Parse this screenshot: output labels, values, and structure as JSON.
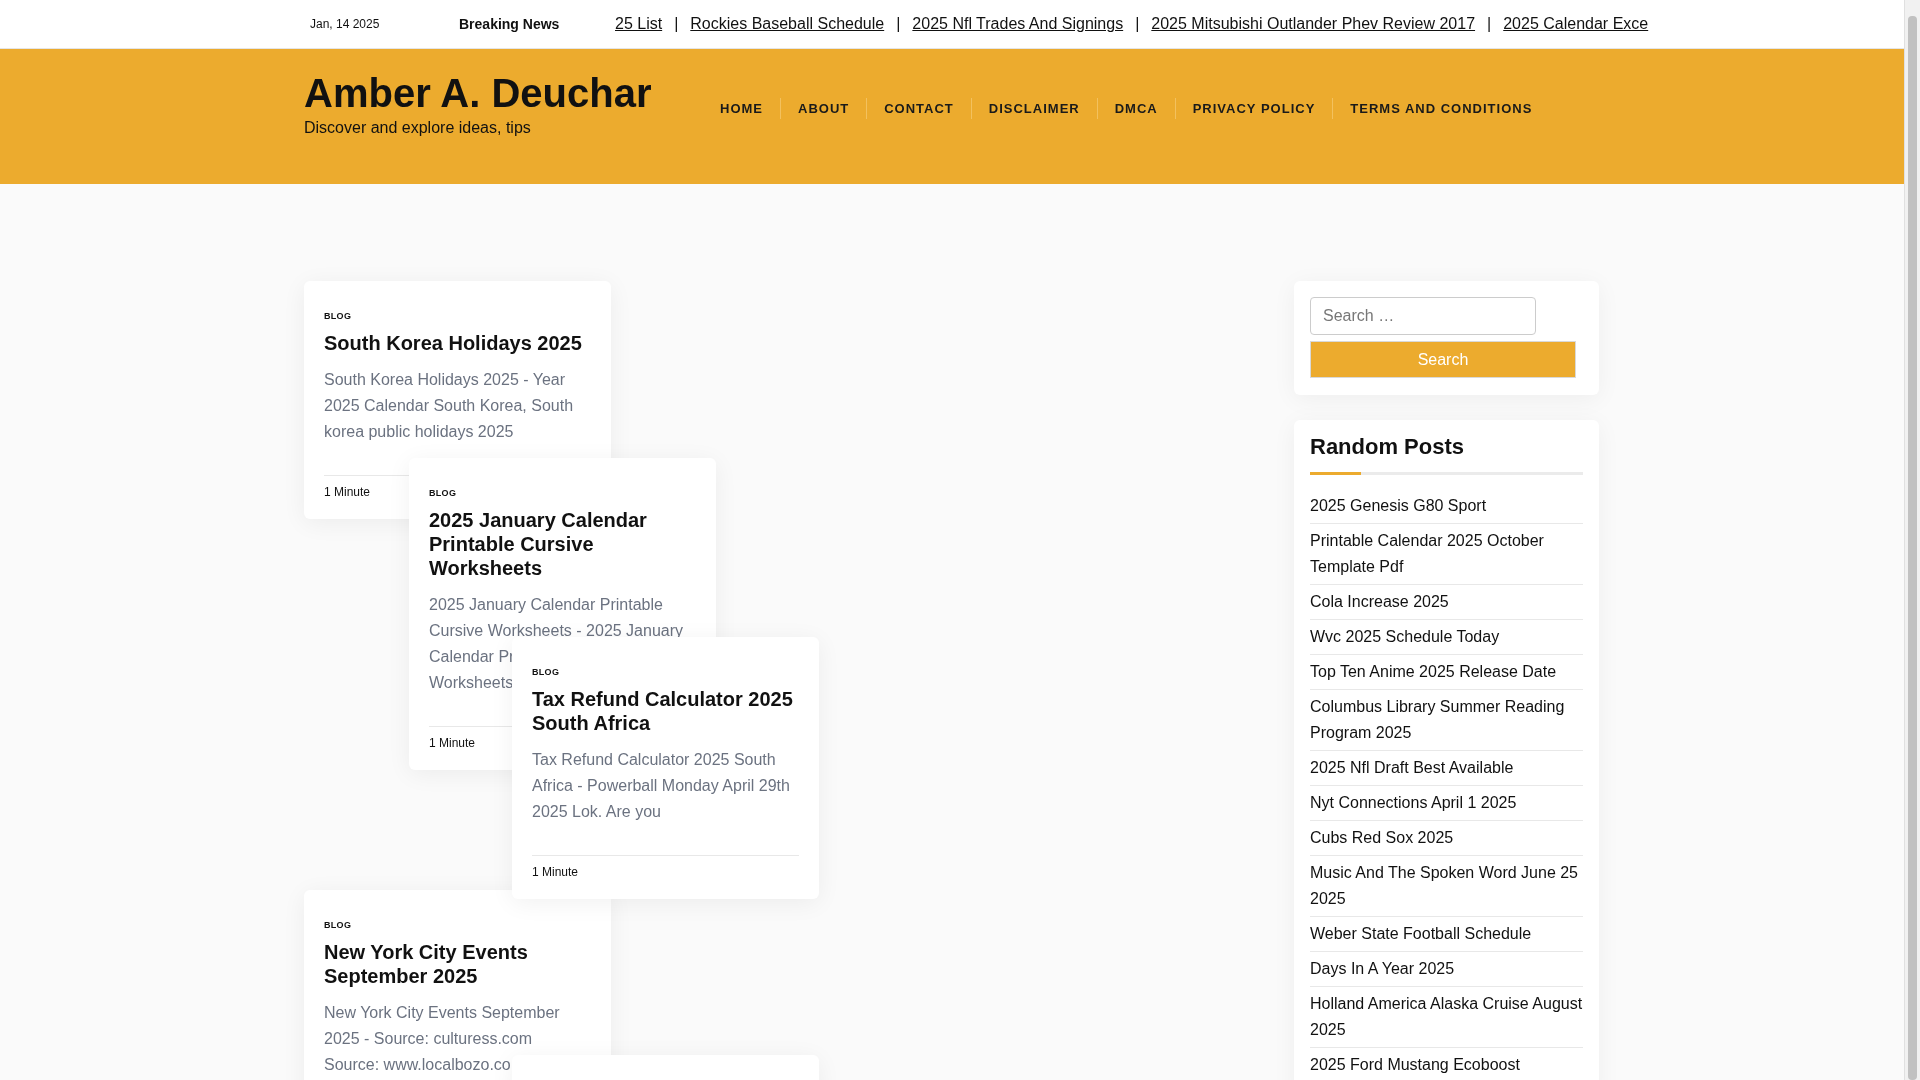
{
  "top_bar": {
    "date": "Jan, 14 2025",
    "breaking_label": "Breaking News",
    "separator": "|",
    "ticker": [
      "25 List",
      "Rockies Baseball Schedule",
      "2025 Nfl Trades And Signings",
      "2025 Mitsubishi Outlander Phev Review 2017",
      "2025 Calendar Exce"
    ]
  },
  "header": {
    "site_title": "Amber A. Deuchar",
    "tagline": "Discover and explore ideas, tips",
    "nav": [
      "HOME",
      "ABOUT",
      "CONTACT",
      "DISCLAIMER",
      "DMCA",
      "PRIVACY POLICY",
      "TERMS AND CONDITIONS"
    ]
  },
  "posts": [
    {
      "category": "BLOG",
      "title": "South Korea Holidays 2025",
      "excerpt_lines": [
        "South Korea Holidays 2025 - Year",
        "2025 Calendar South Korea, South",
        "korea public holidays 2025"
      ],
      "read_time": "1 Minute"
    },
    {
      "category": "BLOG",
      "title": "2025 January Calendar Printable Cursive Worksheets",
      "excerpt_lines": [
        "2025 January Calendar Printable",
        "Cursive Worksheets - 2025 January",
        "Calendar Pr",
        "Worksheets"
      ],
      "read_time": "1 Minute"
    },
    {
      "category": "BLOG",
      "title": "Tax Refund Calculator 2025 South Africa",
      "excerpt_lines": [
        "Tax Refund Calculator 2025 South",
        "Africa - Powerball Monday April 29th",
        "2025 Lok. Are you"
      ],
      "read_time": "1 Minute"
    },
    {
      "category": "BLOG",
      "title": "New York City Events September 2025",
      "excerpt_lines": [
        "New York City Events September",
        "2025 - Source: culturess.com",
        "Source: www.localbozo.co"
      ]
    }
  ],
  "sidebar": {
    "search": {
      "placeholder": "Search …",
      "button": "Search"
    },
    "random_posts": {
      "heading": "Random Posts",
      "items": [
        "2025 Genesis G80 Sport",
        "Printable Calendar 2025 October Template Pdf",
        "Cola Increase 2025",
        "Wvc 2025 Schedule Today",
        "Top Ten Anime 2025 Release Date",
        "Columbus Library Summer Reading Program 2025",
        "2025 Nfl Draft Best Available",
        "Nyt Connections April 1 2025",
        "Cubs Red Sox 2025",
        "Music And The Spoken Word June 25 2025",
        "Weber State Football Schedule",
        "Days In A Year 2025",
        "Holland America Alaska Cruise August 2025",
        "2025 Ford Mustang Ecoboost"
      ]
    }
  }
}
